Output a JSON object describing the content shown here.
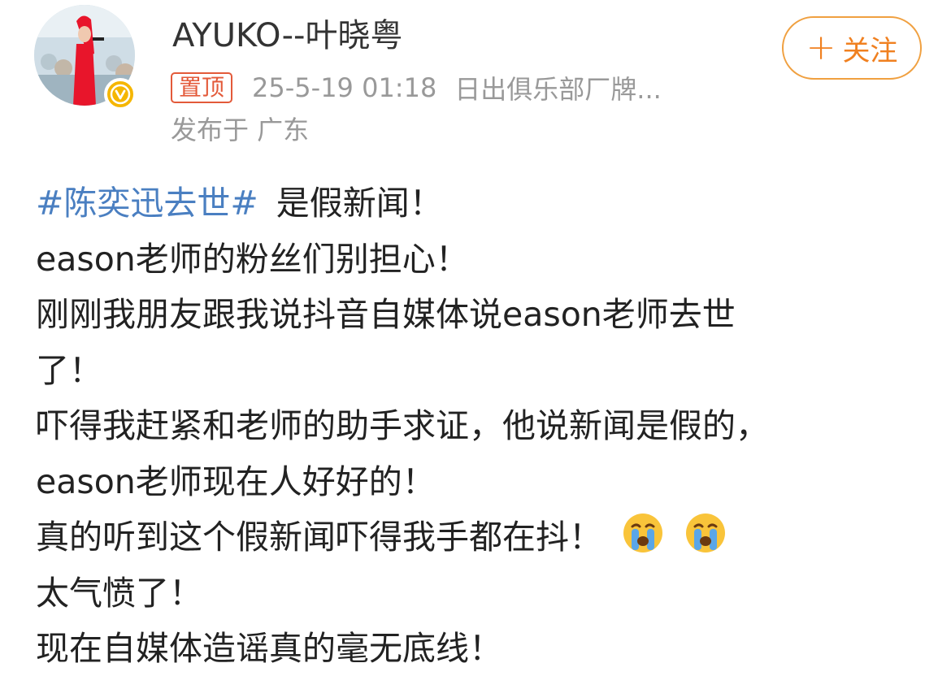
{
  "user": {
    "name": "AYUKO--叶晓粤",
    "avatar_icon": "avatar-performer-photo",
    "verified_icon": "verified-v-badge",
    "verified_letter": "v"
  },
  "follow_button": {
    "plus": "+",
    "label": "关注"
  },
  "meta": {
    "pinned_label": "置顶",
    "timestamp": "25-5-19 01:18",
    "source": "日出俱乐部厂牌...",
    "location": "发布于 广东"
  },
  "post": {
    "hashtag": "#陈奕迅去世#",
    "line1_rest": "是假新闻！",
    "line2": "eason老师的粉丝们别担心！",
    "line3": "刚刚我朋友跟我说抖音自媒体说eason老师去世",
    "line4": "了！",
    "line5": "吓得我赶紧和老师的助手求证，他说新闻是假的，",
    "line6": "eason老师现在人好好的！",
    "line7": "真的听到这个假新闻吓得我手都在抖！",
    "line7_emoji": "crying-face-icon",
    "line8": "太气愤了！",
    "line9": "现在自媒体造谣真的毫无底线！"
  },
  "colors": {
    "hashtag": "#4a7fc1",
    "follow_accent": "#f08020",
    "pinned": "#e35a3a",
    "verified": "#f5b600",
    "meta_gray": "#999999"
  }
}
